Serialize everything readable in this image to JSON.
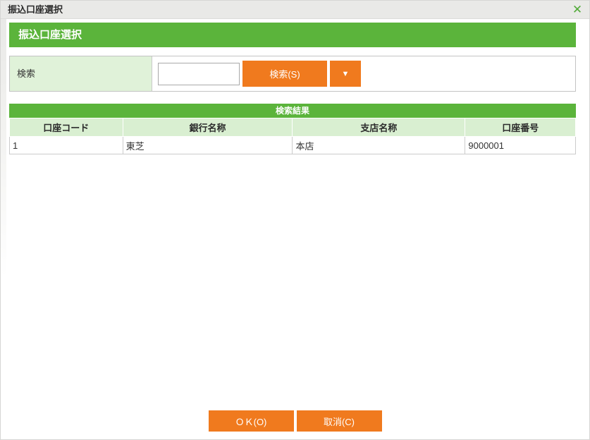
{
  "window": {
    "title": "振込口座選択",
    "close_icon": "✕"
  },
  "header": {
    "title": "振込口座選択"
  },
  "search": {
    "label": "検索",
    "input_value": "",
    "search_button_label": "検索(S)",
    "dropdown_icon": "▼"
  },
  "results": {
    "title": "検索結果",
    "columns": [
      "口座コード",
      "銀行名称",
      "支店名称",
      "口座番号"
    ],
    "rows": [
      [
        "1",
        "東芝",
        "本店",
        "9000001"
      ]
    ]
  },
  "footer": {
    "ok_label": "ＯＫ(O)",
    "cancel_label": "取消(C)"
  },
  "colors": {
    "green": "#5bb43b",
    "light_green_label": "#e0f2d9",
    "light_green_header": "#d9efd1",
    "orange": "#f07a1e",
    "titlebar_gray": "#e9e9e7"
  }
}
